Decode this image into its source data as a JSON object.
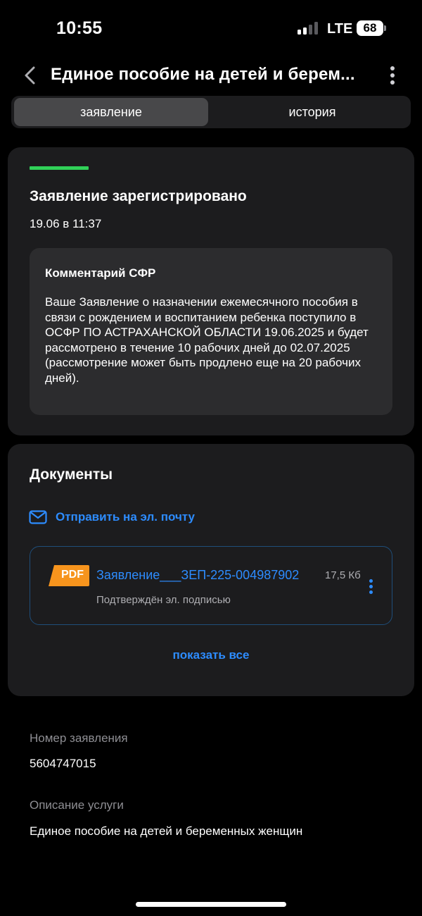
{
  "status_bar": {
    "time": "10:55",
    "network": "LTE",
    "battery": "68"
  },
  "header": {
    "title": "Единое пособие на детей и берем..."
  },
  "tabs": [
    {
      "label": "заявление",
      "active": true
    },
    {
      "label": "история",
      "active": false
    }
  ],
  "status_card": {
    "accent_color": "#30d158",
    "title": "Заявление зарегистрировано",
    "date": "19.06 в 11:37",
    "comment": {
      "title": "Комментарий СФР",
      "text": "Ваше Заявление о назначении ежемесячного пособия в связи с рождением и воспитанием ребенка поступило в ОСФР ПО АСТРАХАНСКОЙ ОБЛАСТИ 19.06.2025 и будет рассмотрено в течение 10 рабочих дней до 02.07.2025 (рассмотрение может быть продлено еще на 20 рабочих дней)."
    }
  },
  "documents": {
    "title": "Документы",
    "email_link": "Отправить на эл. почту",
    "file": {
      "type": "PDF",
      "name": "Заявление___ЗЕП-225-004987902",
      "size": "17,5 Кб",
      "signature": "Подтверждён эл. подписью"
    },
    "show_all": "показать все"
  },
  "details": {
    "number_label": "Номер заявления",
    "number_value": "5604747015",
    "service_label": "Описание услуги",
    "service_value": "Единое пособие на детей и беременных женщин"
  },
  "colors": {
    "accent_blue": "#2d8cff",
    "pdf_orange": "#f7941d",
    "status_green": "#30d158"
  }
}
